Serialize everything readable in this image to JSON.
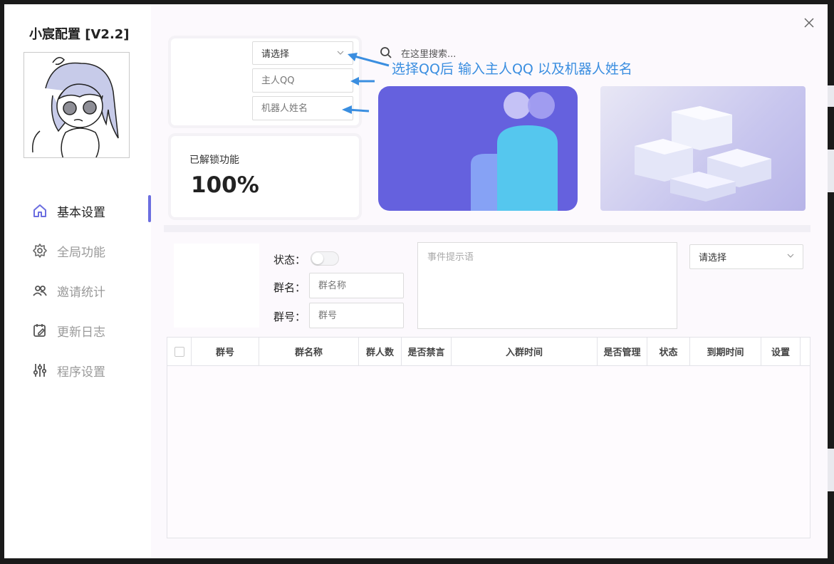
{
  "app": {
    "title": "小宸配置 [V2.2]"
  },
  "nav": {
    "items": [
      {
        "label": "基本设置",
        "icon": "home-icon"
      },
      {
        "label": "全局功能",
        "icon": "gear-icon"
      },
      {
        "label": "邀请统计",
        "icon": "users-icon"
      },
      {
        "label": "更新日志",
        "icon": "calendar-edit-icon"
      },
      {
        "label": "程序设置",
        "icon": "sliders-icon"
      }
    ],
    "active_index": 0
  },
  "config": {
    "qq_select_placeholder": "请选择",
    "master_qq_placeholder": "主人QQ",
    "bot_name_placeholder": "机器人姓名"
  },
  "annotation": "选择QQ后 输入主人QQ 以及机器人姓名",
  "search": {
    "placeholder": "在这里搜索..."
  },
  "stats": {
    "label": "已解锁功能",
    "value": "100%"
  },
  "group_form": {
    "status_label": "状态：",
    "group_name_label": "群名：",
    "group_name_placeholder": "群名称",
    "group_id_label": "群号：",
    "group_id_placeholder": "群号",
    "event_placeholder": "事件提示语",
    "select_placeholder": "请选择"
  },
  "table": {
    "columns": [
      "群号",
      "群名称",
      "群人数",
      "是否禁言",
      "入群时间",
      "是否管理",
      "状态",
      "到期时间",
      "设置"
    ]
  },
  "colors": {
    "accent": "#6b6ee0",
    "annotation": "#3a8ee0",
    "banner_purple": "#6561de",
    "banner_cyan": "#55c7ee"
  }
}
